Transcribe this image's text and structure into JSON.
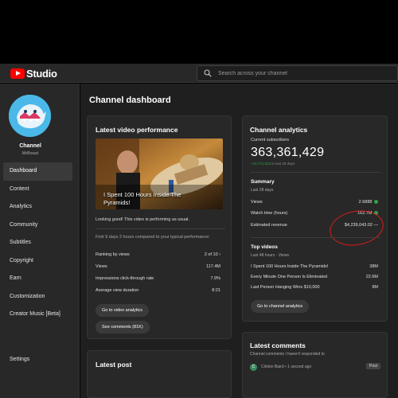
{
  "app": {
    "logo_text": "Studio"
  },
  "search": {
    "placeholder": "Search across your channel"
  },
  "sidebar": {
    "channel_label": "Channel",
    "channel_name": "MrBeast",
    "items": [
      {
        "label": "Dashboard",
        "active": true
      },
      {
        "label": "Content"
      },
      {
        "label": "Analytics"
      },
      {
        "label": "Community"
      },
      {
        "label": "Subtitles"
      },
      {
        "label": "Copyright"
      },
      {
        "label": "Earn"
      },
      {
        "label": "Customization"
      },
      {
        "label": "Creator Music [Beta]"
      }
    ],
    "settings_label": "Settings"
  },
  "main": {
    "title": "Channel dashboard"
  },
  "latest_video": {
    "title": "Latest video performance",
    "video_title": "I Spent 100 Hours Inside The Pyramids!",
    "note": "Looking good! This video is performing as usual.",
    "compare": "First 9 days 2 hours compared to your typical performance:",
    "metrics": [
      {
        "label": "Ranking by views",
        "value": "2 of 10  ›"
      },
      {
        "label": "Views",
        "value": "117.4M"
      },
      {
        "label": "Impressions click-through rate",
        "value": "7.9%"
      },
      {
        "label": "Average view duration",
        "value": "8:21"
      }
    ],
    "btn_analytics": "Go to video analytics",
    "btn_comments": "See comments (81K)"
  },
  "latest_post": {
    "title": "Latest post"
  },
  "channel_analytics": {
    "title": "Channel analytics",
    "subs_label": "Current subscribers",
    "subs_count": "363,361,429",
    "subs_delta": "+15,771,023",
    "subs_delta_period": " in last 28 days",
    "summary_title": "Summary",
    "summary_period": "Last 28 days",
    "summary_rows": [
      {
        "label": "Views",
        "value": "2.6888"
      },
      {
        "label": "Watch time (hours)",
        "value": "162.7M"
      },
      {
        "label": "Estimated revenue",
        "value": "$4,239,043.02 —"
      }
    ],
    "top_title": "Top videos",
    "top_period": "Last 48 hours · Views",
    "top_rows": [
      {
        "label": "I Spent 100 Hours Inside The Pyramids!",
        "value": "38M"
      },
      {
        "label": "Every Minute One Person Is Eliminated",
        "value": "22.6M"
      },
      {
        "label": "Last Person Hanging Wins $10,000",
        "value": "9M"
      }
    ],
    "btn": "Go to channel analytics"
  },
  "comments": {
    "title": "Latest comments",
    "subtitle": "Channel comments I haven't responded to",
    "author": "Clinton Baird • 1 second ago",
    "avatar_letter": "C",
    "badge": "Post"
  },
  "colors": {
    "accent_red": "#ff0000",
    "positive_green": "#2ba640",
    "annotation_red": "#e01a1a"
  }
}
